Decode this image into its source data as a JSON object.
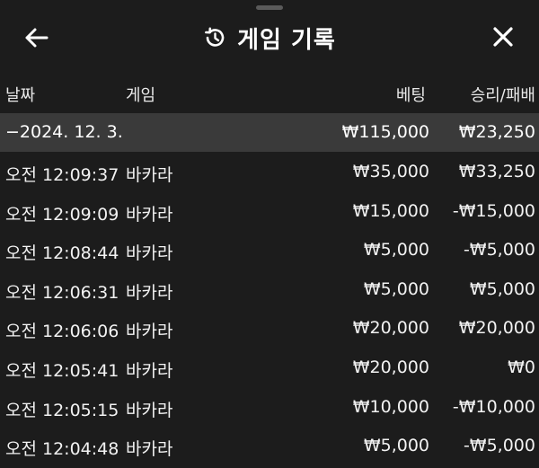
{
  "header": {
    "title": "게임 기록",
    "back_icon": "arrow-left-icon",
    "history_icon": "history-icon",
    "close_icon": "close-icon"
  },
  "columns": {
    "date": "날짜",
    "game": "게임",
    "bet": "베팅",
    "win_loss": "승리/패배"
  },
  "group": {
    "date": "−2024. 12. 3.",
    "bet_total": "₩115,000",
    "win_total": "₩23,250"
  },
  "rows": [
    {
      "time": "오전 12:09:37",
      "game": "바카라",
      "bet": "₩35,000",
      "win": "₩33,250"
    },
    {
      "time": "오전 12:09:09",
      "game": "바카라",
      "bet": "₩15,000",
      "win": "-₩15,000"
    },
    {
      "time": "오전 12:08:44",
      "game": "바카라",
      "bet": "₩5,000",
      "win": "-₩5,000"
    },
    {
      "time": "오전 12:06:31",
      "game": "바카라",
      "bet": "₩5,000",
      "win": "₩5,000"
    },
    {
      "time": "오전 12:06:06",
      "game": "바카라",
      "bet": "₩20,000",
      "win": "₩20,000"
    },
    {
      "time": "오전 12:05:41",
      "game": "바카라",
      "bet": "₩20,000",
      "win": "₩0"
    },
    {
      "time": "오전 12:05:15",
      "game": "바카라",
      "bet": "₩10,000",
      "win": "-₩10,000"
    },
    {
      "time": "오전 12:04:48",
      "game": "바카라",
      "bet": "₩5,000",
      "win": "-₩5,000"
    }
  ]
}
